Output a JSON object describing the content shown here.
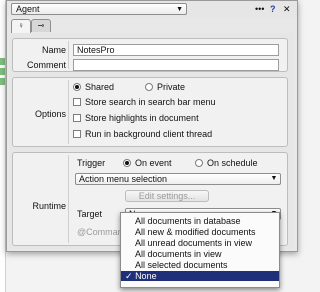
{
  "header": {
    "agent_label": "Agent",
    "icons": [
      "lightbulb-icon",
      "key-icon"
    ]
  },
  "tabs": [
    {
      "icon": "lightbulb-icon",
      "glyph": "♀",
      "active": true
    },
    {
      "icon": "key-icon",
      "glyph": "⊸",
      "active": false
    }
  ],
  "basics": {
    "name_label": "Name",
    "name_value": "NotesPro",
    "comment_label": "Comment",
    "comment_value": ""
  },
  "options": {
    "label": "Options",
    "shared": "Shared",
    "private": "Private",
    "store_search": "Store search in search bar menu",
    "store_highlights": "Store highlights in document",
    "run_background": "Run in background client thread"
  },
  "runtime": {
    "label": "Runtime",
    "trigger_label": "Trigger",
    "on_event": "On event",
    "on_schedule": "On schedule",
    "event_value": "Action menu selection",
    "edit_settings": "Edit settings...",
    "target_label": "Target",
    "target_value": "None",
    "commands_text": "@Commands n"
  },
  "target_menu": {
    "items": [
      "All documents in database",
      "All new & modified documents",
      "All unread documents in view",
      "All documents in view",
      "All selected documents",
      "None"
    ],
    "selected_index": 5,
    "check": "✓"
  },
  "colors": {
    "selection": "#1f2f78",
    "panel": "#e8e8e8",
    "background_green": "#7fbf7f"
  }
}
